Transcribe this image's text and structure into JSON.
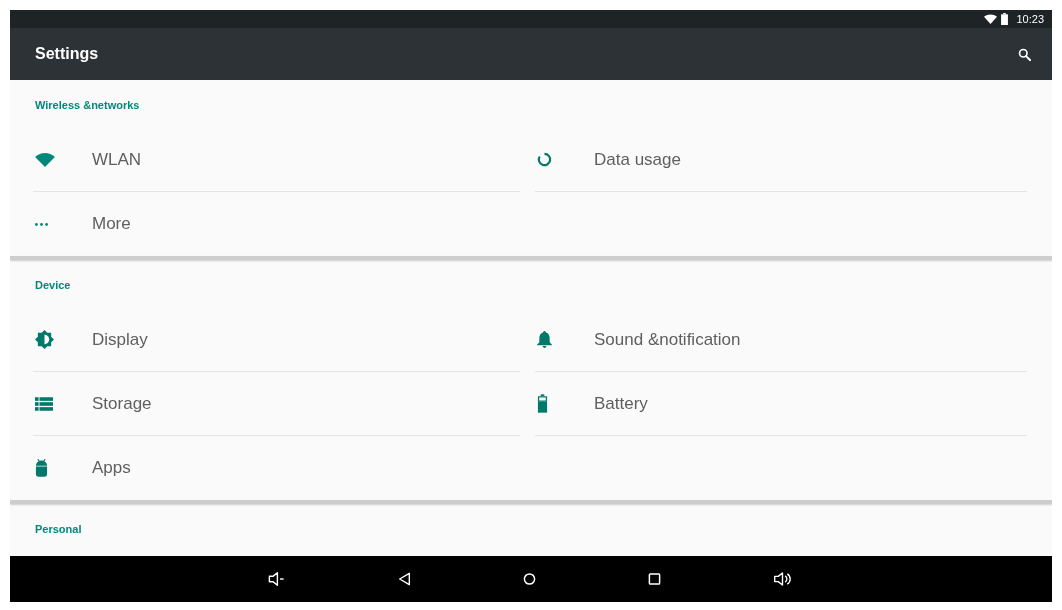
{
  "status_bar": {
    "time": "10:23"
  },
  "app_bar": {
    "title": "Settings"
  },
  "sections": [
    {
      "title": "Wireless &networks",
      "items": [
        {
          "label": "WLAN"
        },
        {
          "label": "Data usage"
        },
        {
          "label": "More"
        }
      ]
    },
    {
      "title": "Device",
      "items": [
        {
          "label": "Display"
        },
        {
          "label": "Sound &notification"
        },
        {
          "label": "Storage"
        },
        {
          "label": "Battery"
        },
        {
          "label": "Apps"
        }
      ]
    },
    {
      "title": "Personal"
    }
  ]
}
